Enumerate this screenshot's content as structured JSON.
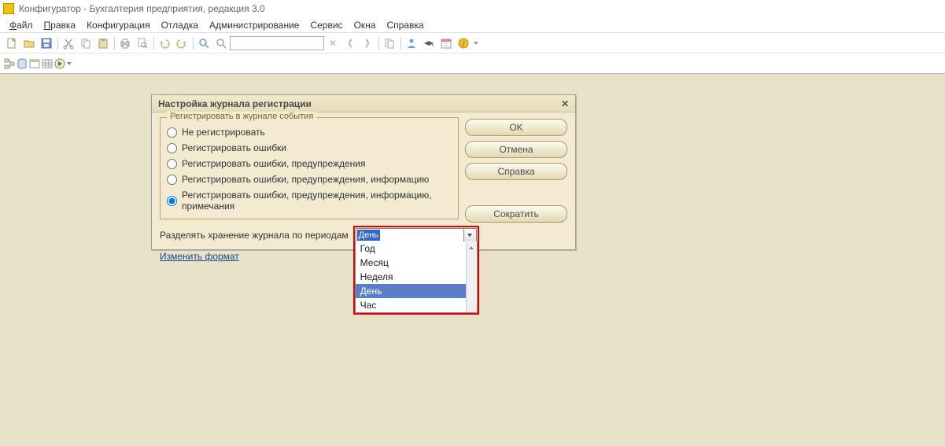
{
  "app": {
    "title": "Конфигуратор - Бухгалтерия предприятия, редакция 3.0"
  },
  "menubar": {
    "file": {
      "label": "Файл",
      "accel_pos": 0
    },
    "edit": {
      "label": "Правка",
      "accel_pos": 0
    },
    "config": {
      "label": "Конфигурация"
    },
    "debug": {
      "label": "Отладка"
    },
    "admin": {
      "label": "Администрирование"
    },
    "service": {
      "label": "Сервис"
    },
    "windows": {
      "label": "Окна"
    },
    "help": {
      "label": "Справка"
    }
  },
  "dialog": {
    "title": "Настройка журнала регистрации",
    "fieldset_legend": "Регистрировать в журнале события",
    "radios": [
      {
        "id": "r0",
        "label": "Не регистрировать",
        "checked": false
      },
      {
        "id": "r1",
        "label": "Регистрировать ошибки",
        "checked": false
      },
      {
        "id": "r2",
        "label": "Регистрировать ошибки, предупреждения",
        "checked": false
      },
      {
        "id": "r3",
        "label": "Регистрировать ошибки, предупреждения, информацию",
        "checked": false
      },
      {
        "id": "r4",
        "label": "Регистрировать ошибки, предупреждения, информацию, примечания",
        "checked": true
      }
    ],
    "period_label": "Разделять хранение журнала по периодам",
    "period_value": "День",
    "period_options": [
      "Год",
      "Месяц",
      "Неделя",
      "День",
      "Час"
    ],
    "change_format_link": "Изменить формат",
    "buttons": {
      "ok": "OK",
      "cancel": "Отмена",
      "help": "Справка",
      "shrink": "Сократить"
    }
  }
}
